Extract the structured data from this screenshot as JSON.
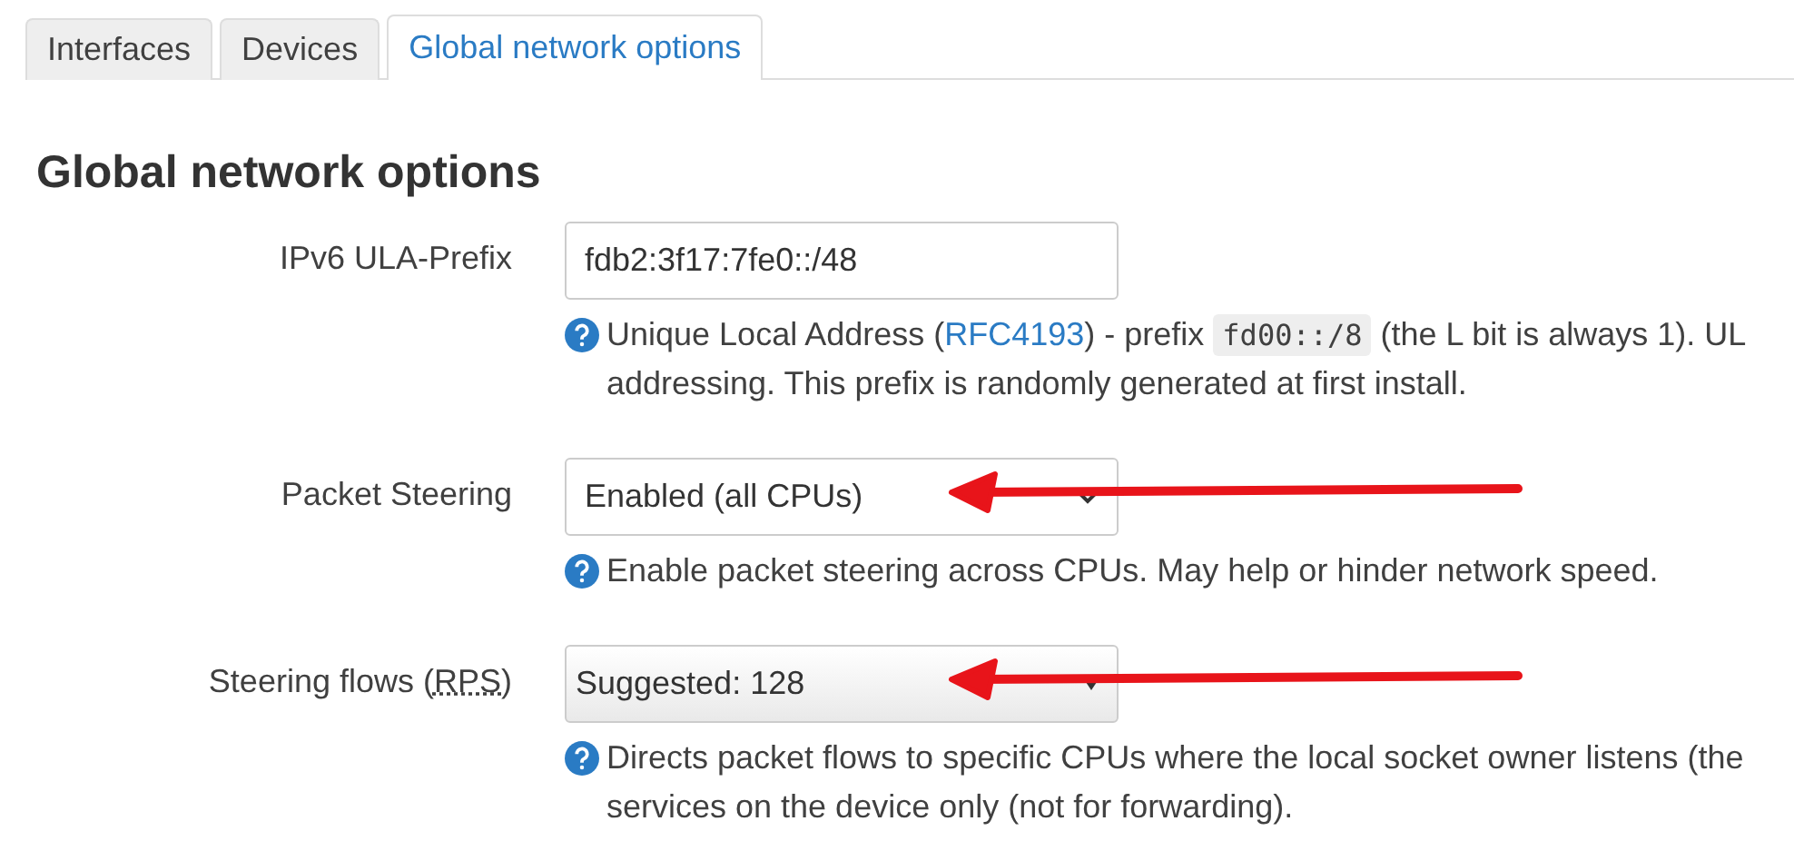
{
  "tabs": [
    {
      "label": "Interfaces",
      "selected": false
    },
    {
      "label": "Devices",
      "selected": false
    },
    {
      "label": "Global network options",
      "selected": true
    }
  ],
  "heading": "Global network options",
  "fields": [
    {
      "kind": "input",
      "label": [
        {
          "kind": "text",
          "text": "IPv6 ULA-Prefix"
        }
      ],
      "value": "fdb2:3f17:7fe0::/48",
      "arrow": false,
      "help": [
        [
          {
            "kind": "text",
            "text": "Unique Local Address ("
          },
          {
            "kind": "link",
            "text": "RFC4193"
          },
          {
            "kind": "text",
            "text": ") - prefix "
          },
          {
            "kind": "code",
            "text": "fd00::/8"
          },
          {
            "kind": "text",
            "text": " (the L bit is always 1). UL"
          }
        ],
        [
          {
            "kind": "text",
            "text": "addressing. This prefix is randomly generated at first install."
          }
        ]
      ]
    },
    {
      "kind": "select",
      "label": [
        {
          "kind": "text",
          "text": "Packet Steering"
        }
      ],
      "value": "Enabled (all CPUs)",
      "arrow": true,
      "help": [
        [
          {
            "kind": "text",
            "text": "Enable packet steering across CPUs. May help or hinder network speed."
          }
        ]
      ]
    },
    {
      "kind": "combo",
      "label": [
        {
          "kind": "text",
          "text": "Steering flows ("
        },
        {
          "kind": "abbr",
          "text": "RPS"
        },
        {
          "kind": "text",
          "text": ")"
        }
      ],
      "value": "Suggested: 128",
      "arrow": true,
      "help": [
        [
          {
            "kind": "text",
            "text": "Directs packet flows to specific CPUs where the local socket owner listens (the"
          }
        ],
        [
          {
            "kind": "text",
            "text": "services on the device only (not for forwarding)."
          }
        ]
      ]
    }
  ]
}
